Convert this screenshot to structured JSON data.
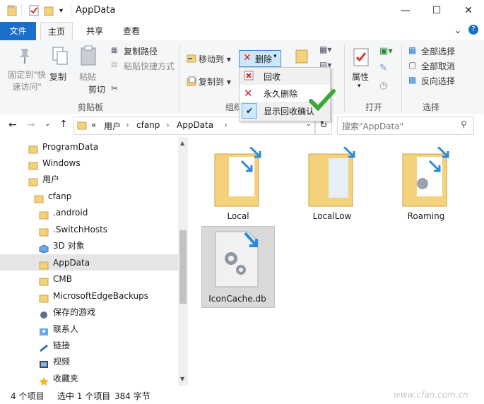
{
  "window": {
    "title": "AppData",
    "minimize": "—",
    "maximize": "☐",
    "close": "✕"
  },
  "tabs": {
    "file": "文件",
    "home": "主页",
    "share": "共享",
    "view": "查看"
  },
  "ribbon": {
    "pin": "固定到\"快\n速访问\"",
    "copy": "复制",
    "paste": "粘贴",
    "copy_path": "复制路径",
    "paste_shortcut": "粘贴快捷方式",
    "cut": "剪切",
    "group_clipboard": "剪贴板",
    "move_to": "移动到",
    "copy_to": "复制到",
    "delete": "删除",
    "group_organize": "组织",
    "properties": "属性",
    "group_open": "打开",
    "select_all": "全部选择",
    "select_none": "全部取消",
    "invert": "反向选择",
    "group_select": "选择"
  },
  "delete_menu": {
    "recycle": "回收",
    "permanent": "永久删除",
    "show_confirm": "显示回收确认"
  },
  "address": {
    "path": [
      "«",
      "用户",
      "cfanp",
      "AppData"
    ],
    "search_placeholder": "搜索\"AppData\""
  },
  "nav": [
    {
      "label": "ProgramData",
      "indent": 0
    },
    {
      "label": "Windows",
      "indent": 0
    },
    {
      "label": "用户",
      "indent": 0
    },
    {
      "label": "cfanp",
      "indent": 1
    },
    {
      "label": ".android",
      "indent": 2
    },
    {
      "label": ".SwitchHosts",
      "indent": 2
    },
    {
      "label": "3D 对象",
      "indent": 2
    },
    {
      "label": "AppData",
      "indent": 2,
      "selected": true
    },
    {
      "label": "CMB",
      "indent": 2
    },
    {
      "label": "MicrosoftEdgeBackups",
      "indent": 2
    },
    {
      "label": "保存的游戏",
      "indent": 2
    },
    {
      "label": "联系人",
      "indent": 2
    },
    {
      "label": "链接",
      "indent": 2
    },
    {
      "label": "视频",
      "indent": 2
    },
    {
      "label": "收藏夹",
      "indent": 2
    }
  ],
  "files": [
    {
      "name": "Local"
    },
    {
      "name": "LocalLow"
    },
    {
      "name": "Roaming"
    },
    {
      "name": "IconCache.db"
    }
  ],
  "status": {
    "count": "4 个项目",
    "selected": "选中 1 个项目",
    "size": "384 字节"
  },
  "watermark": "www.cfan.com.cn",
  "colors": {
    "accent": "#1a6fc9",
    "folder": "#f3d27b",
    "selection": "#cce8ff"
  }
}
